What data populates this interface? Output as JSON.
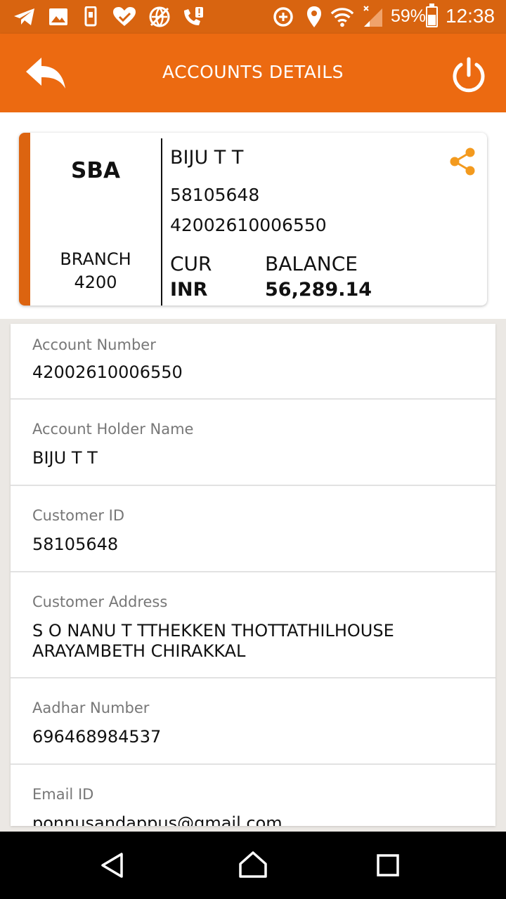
{
  "status_bar": {
    "battery_text": "59%",
    "battery_level": 0.59,
    "clock": "12:38",
    "icons": [
      "telegram-icon",
      "gallery-icon",
      "phone-data-icon",
      "health-icon",
      "vpn-globe-icon",
      "call-alert-icon",
      "data-saver-icon",
      "location-icon",
      "wifi-icon",
      "signal-icon",
      "battery-icon"
    ]
  },
  "app_bar": {
    "title": "ACCOUNTS DETAILS",
    "accent_color": "#ec6a11"
  },
  "card": {
    "account_type": "SBA",
    "branch_label": "BRANCH",
    "branch_code": "4200",
    "holder_name": "BIJU T T",
    "customer_id": "58105648",
    "account_number": "42002610006550",
    "currency_label": "CUR",
    "currency_value": "INR",
    "balance_label": "BALANCE",
    "balance_value": "56,289.14",
    "share_color": "#f39a1e"
  },
  "details": {
    "account_number": {
      "label": "Account Number",
      "value": "42002610006550"
    },
    "holder_name": {
      "label": "Account Holder Name",
      "value": "BIJU T T"
    },
    "customer_id": {
      "label": "Customer ID",
      "value": "58105648"
    },
    "address": {
      "label": "Customer Address",
      "line1": "S O NANU T TTHEKKEN THOTTATHILHOUSE",
      "line2": "ARAYAMBETH CHIRAKKAL"
    },
    "aadhar": {
      "label": "Aadhar Number",
      "value": "696468984537"
    },
    "email": {
      "label": "Email ID",
      "value": "ponnusandappus@gmail.com"
    }
  },
  "nav_bar": {
    "icons": [
      "back-triangle-icon",
      "home-icon",
      "recents-square-icon"
    ]
  }
}
